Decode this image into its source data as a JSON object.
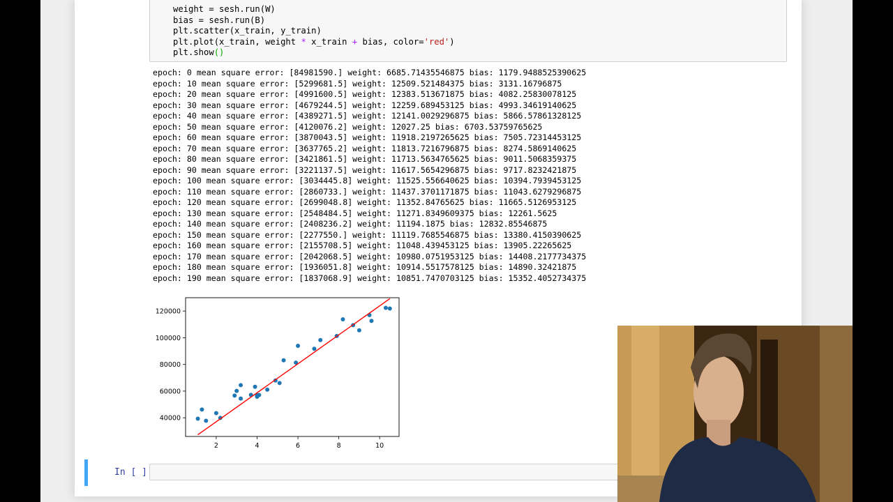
{
  "code_cell": {
    "lines": [
      {
        "parts": [
          {
            "t": "weight = sesh.run(W)",
            "c": ""
          }
        ]
      },
      {
        "parts": [
          {
            "t": "bias = sesh.run(B)",
            "c": ""
          }
        ]
      },
      {
        "parts": [
          {
            "t": "plt.scatter(x_train, y_train)",
            "c": ""
          }
        ]
      },
      {
        "parts": [
          {
            "t": "plt.plot(x_train, weight ",
            "c": ""
          },
          {
            "t": "*",
            "c": "op"
          },
          {
            "t": " x_train ",
            "c": ""
          },
          {
            "t": "+",
            "c": "op"
          },
          {
            "t": " bias, color=",
            "c": ""
          },
          {
            "t": "'red'",
            "c": "str"
          },
          {
            "t": ")",
            "c": ""
          }
        ]
      },
      {
        "parts": [
          {
            "t": "plt.show",
            "c": ""
          },
          {
            "t": "()",
            "c": "paren-hl"
          }
        ]
      }
    ]
  },
  "output": {
    "lines": [
      "epoch: 0 mean square error: [84981590.] weight: 6685.71435546875 bias: 1179.9488525390625",
      "epoch: 10 mean square error: [5299681.5] weight: 12509.521484375 bias: 3131.16796875",
      "epoch: 20 mean square error: [4991600.5] weight: 12383.513671875 bias: 4082.25830078125",
      "epoch: 30 mean square error: [4679244.5] weight: 12259.689453125 bias: 4993.34619140625",
      "epoch: 40 mean square error: [4389271.5] weight: 12141.0029296875 bias: 5866.57861328125",
      "epoch: 50 mean square error: [4120076.2] weight: 12027.25 bias: 6703.53759765625",
      "epoch: 60 mean square error: [3870043.5] weight: 11918.2197265625 bias: 7505.72314453125",
      "epoch: 70 mean square error: [3637765.2] weight: 11813.7216796875 bias: 8274.5869140625",
      "epoch: 80 mean square error: [3421861.5] weight: 11713.5634765625 bias: 9011.5068359375",
      "epoch: 90 mean square error: [3221137.5] weight: 11617.5654296875 bias: 9717.8232421875",
      "epoch: 100 mean square error: [3034445.8] weight: 11525.556640625 bias: 10394.7939453125",
      "epoch: 110 mean square error: [2860733.] weight: 11437.3701171875 bias: 11043.6279296875",
      "epoch: 120 mean square error: [2699048.8] weight: 11352.84765625 bias: 11665.5126953125",
      "epoch: 130 mean square error: [2548484.5] weight: 11271.8349609375 bias: 12261.5625",
      "epoch: 140 mean square error: [2408236.2] weight: 11194.1875 bias: 12832.85546875",
      "epoch: 150 mean square error: [2277550.] weight: 11119.7685546875 bias: 13380.4150390625",
      "epoch: 160 mean square error: [2155708.5] weight: 11048.439453125 bias: 13905.22265625",
      "epoch: 170 mean square error: [2042068.5] weight: 10980.0751953125 bias: 14408.2177734375",
      "epoch: 180 mean square error: [1936051.8] weight: 10914.5517578125 bias: 14890.32421875",
      "epoch: 190 mean square error: [1837068.9] weight: 10851.7470703125 bias: 15352.4052734375"
    ]
  },
  "chart_data": {
    "type": "scatter",
    "title": "",
    "xlabel": "",
    "ylabel": "",
    "xlim": [
      0.5,
      10.95
    ],
    "ylim": [
      26000,
      130000
    ],
    "xticks": [
      2,
      4,
      6,
      8,
      10
    ],
    "yticks": [
      40000,
      60000,
      80000,
      100000,
      120000
    ],
    "grid": false,
    "points": [
      [
        1.1,
        39343
      ],
      [
        1.3,
        46205
      ],
      [
        1.5,
        37731
      ],
      [
        2.0,
        43525
      ],
      [
        2.2,
        39891
      ],
      [
        2.9,
        56642
      ],
      [
        3.0,
        60150
      ],
      [
        3.2,
        54445
      ],
      [
        3.2,
        64445
      ],
      [
        3.7,
        57189
      ],
      [
        3.9,
        63218
      ],
      [
        4.0,
        55794
      ],
      [
        4.0,
        56957
      ],
      [
        4.1,
        57081
      ],
      [
        4.5,
        61111
      ],
      [
        4.9,
        67938
      ],
      [
        5.1,
        66029
      ],
      [
        5.3,
        83088
      ],
      [
        5.9,
        81363
      ],
      [
        6.0,
        93940
      ],
      [
        6.8,
        91738
      ],
      [
        7.1,
        98273
      ],
      [
        7.9,
        101302
      ],
      [
        8.2,
        113812
      ],
      [
        8.7,
        109431
      ],
      [
        9.0,
        105582
      ],
      [
        9.5,
        116969
      ],
      [
        9.6,
        112635
      ],
      [
        10.3,
        122391
      ],
      [
        10.5,
        121872
      ]
    ],
    "fit_line": {
      "color": "#ff0000",
      "x": [
        1.1,
        10.5
      ],
      "y": [
        27289,
        129290
      ]
    },
    "point_color": "#1f77b4"
  },
  "input_cell": {
    "prompt": "In [ ]:",
    "value": ""
  }
}
